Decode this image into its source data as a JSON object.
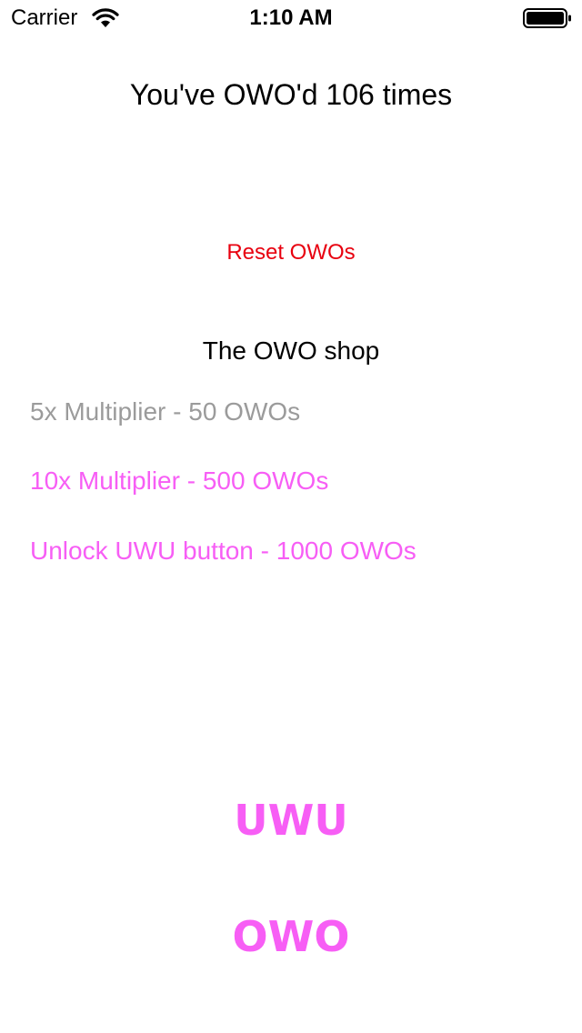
{
  "status_bar": {
    "carrier": "Carrier",
    "time": "1:10 AM",
    "wifi_icon": "wifi-icon",
    "battery_icon": "battery-full-icon"
  },
  "counter_text": "You've OWO'd 106 times",
  "reset_label": "Reset OWOs",
  "shop": {
    "title": "The OWO shop",
    "items": [
      {
        "label": "5x Multiplier - 50 OWOs",
        "state": "disabled"
      },
      {
        "label": "10x Multiplier - 500 OWOs",
        "state": "enabled"
      },
      {
        "label": "Unlock UWU button - 1000 OWOs",
        "state": "enabled"
      }
    ]
  },
  "uwu_button": "UWU",
  "owo_button": "OWO",
  "colors": {
    "accent_pink": "#f75ef5",
    "reset_red": "#e8000f",
    "disabled_gray": "#9b9b9b"
  }
}
